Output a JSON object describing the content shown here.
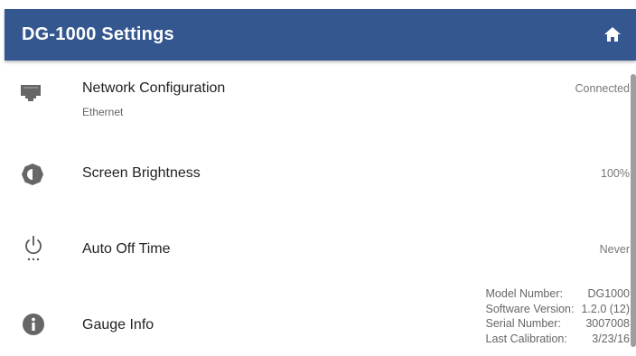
{
  "header": {
    "title": "DG-1000 Settings",
    "home_icon": "home-icon",
    "background_color": "#34578f"
  },
  "settings": {
    "network": {
      "icon": "ethernet-port-icon",
      "title": "Network Configuration",
      "subtitle": "Ethernet",
      "value": "Connected"
    },
    "brightness": {
      "icon": "brightness-icon",
      "title": "Screen Brightness",
      "value": "100%"
    },
    "auto_off": {
      "icon": "power-timer-icon",
      "title": "Auto Off Time",
      "value": "Never"
    },
    "gauge_info": {
      "icon": "info-icon",
      "title": "Gauge Info",
      "details": [
        {
          "label": "Model Number:",
          "value": "DG1000"
        },
        {
          "label": "Software Version:",
          "value": "1.2.0 (12)"
        },
        {
          "label": "Serial Number:",
          "value": "3007008"
        },
        {
          "label": "Last Calibration:",
          "value": "3/23/16"
        }
      ]
    }
  }
}
